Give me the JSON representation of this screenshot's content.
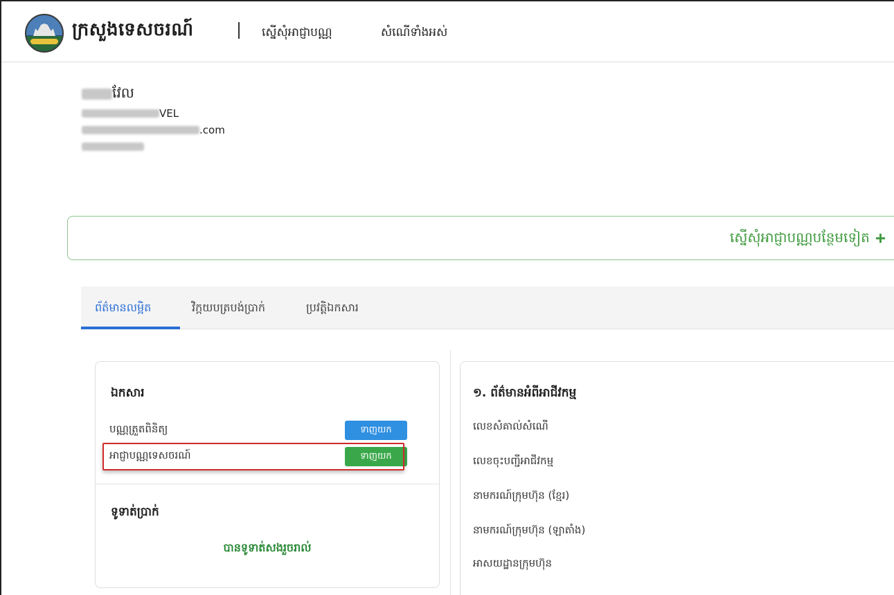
{
  "header": {
    "brand": "ក្រសួងទេសចរណ៍",
    "nav": [
      {
        "label": "ស្នើសុំអាជ្ញាបណ្ណ"
      },
      {
        "label": "សំណើទាំងអស់"
      }
    ]
  },
  "user": {
    "name_suffix": "វែល",
    "latin_suffix": "VEL",
    "email_suffix": ".com"
  },
  "add_license": {
    "label": "ស្នើសុំអាជ្ញាបណ្ណបន្ថែមទៀត",
    "icon": "plus-icon"
  },
  "tabs": [
    {
      "label": "ព័ត៌មានលម្អិត",
      "active": true
    },
    {
      "label": "វិក្កយបត្របង់ប្រាក់",
      "active": false
    },
    {
      "label": "ប្រវត្តិឯកសារ",
      "active": false
    }
  ],
  "documents": {
    "title": "ឯកសារ",
    "items": [
      {
        "label": "បណ្ណត្រួតពិនិត្យ",
        "button": "ទាញយក",
        "color": "#2f8fe0"
      },
      {
        "label": "អាជ្ញាបណ្ណទេសចរណ៍",
        "button": "ទាញយក",
        "color": "#3aa84a"
      }
    ]
  },
  "payment": {
    "title": "ទូទាត់ប្រាក់",
    "status": "បានទូទាត់សងរួចរាល់"
  },
  "business": {
    "title": "១. ព័ត៌មានអំពីអាជីវកម្ម",
    "fields": [
      "លេខសំគាល់សំណើ",
      "លេខចុះបញ្ជីអាជីវកម្ម",
      "នាមករណ៍ក្រុមហ៊ុន (ខ្មែរ)",
      "នាមករណ៍ក្រុមហ៊ុន (ឡាតាំង)",
      "អាសយដ្ឋានក្រុមហ៊ុន"
    ]
  },
  "colors": {
    "accent_blue": "#2a6fd6",
    "success_green": "#3aa84a",
    "highlight_red": "#d22a2a"
  }
}
